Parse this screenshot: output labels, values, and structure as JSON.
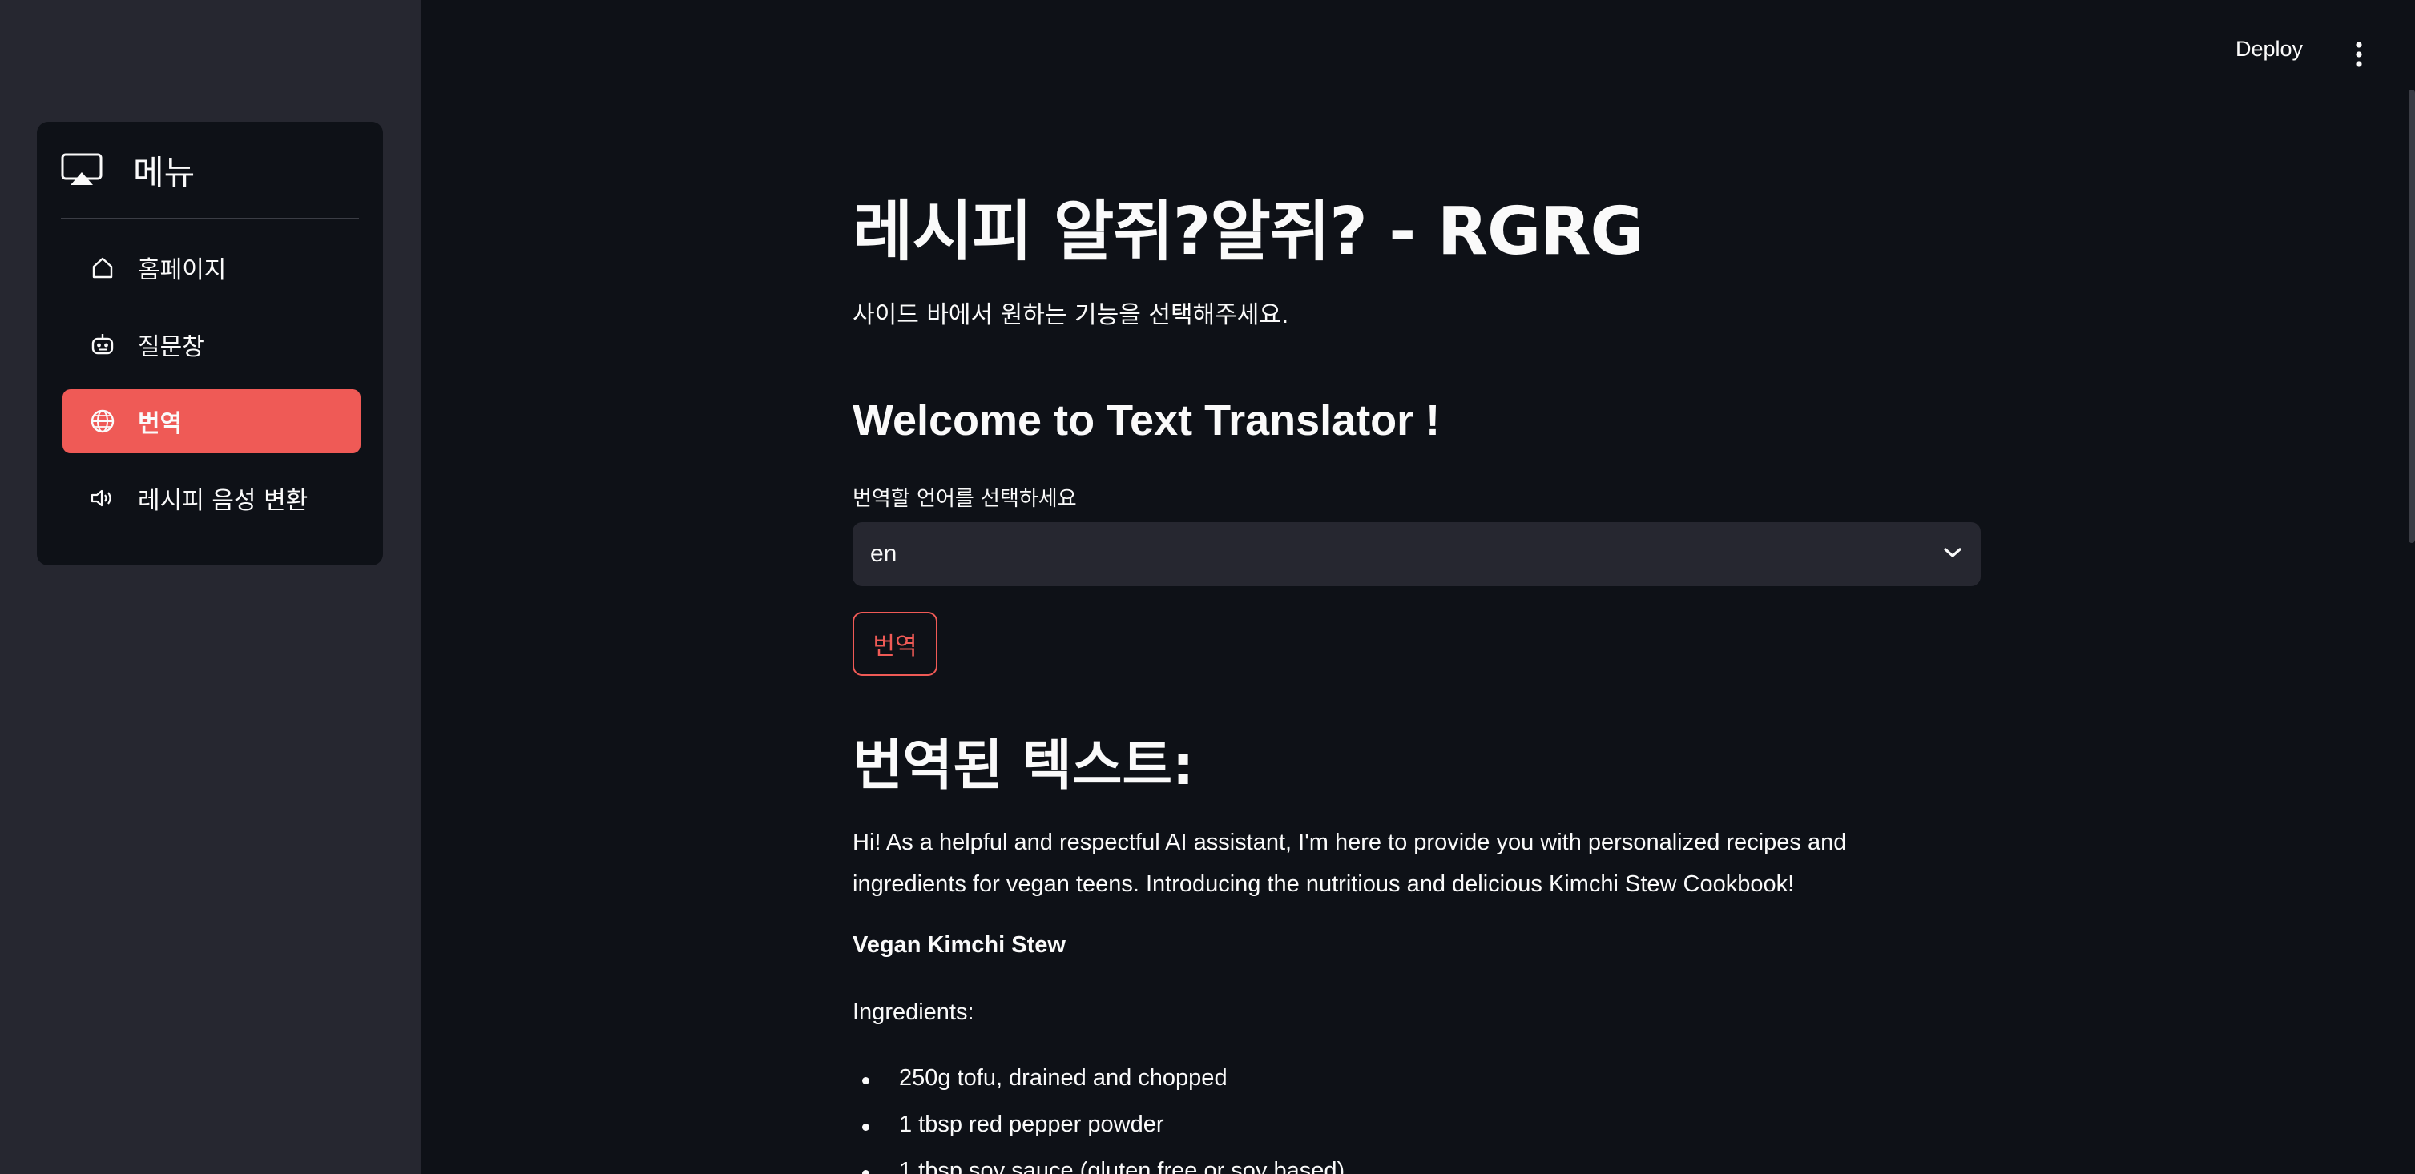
{
  "sidebar": {
    "menu_title": "메뉴",
    "menu_icon": "airplay-icon",
    "items": [
      {
        "label": "홈페이지",
        "icon": "house-icon",
        "active": false
      },
      {
        "label": "질문창",
        "icon": "robot-icon",
        "active": false
      },
      {
        "label": "번역",
        "icon": "globe-icon",
        "active": true
      },
      {
        "label": "레시피 음성 변환",
        "icon": "speaker-icon",
        "active": false
      }
    ]
  },
  "header": {
    "deploy_label": "Deploy",
    "menu_icon": "kebab-menu-icon"
  },
  "main": {
    "title": "레시피 알쥐?알쥐? - RGRG",
    "subtitle": "사이드 바에서 원하는 기능을 선택해주세요.",
    "section_heading": "Welcome to Text Translator !",
    "select_label": "번역할 언어를 선택하세요",
    "select_value": "en",
    "translate_button": "번역",
    "result_heading": "번역된 텍스트:",
    "result_paragraph": "Hi! As a helpful and respectful AI assistant, I'm here to provide you with personalized recipes and ingredients for vegan teens. Introducing the nutritious and delicious Kimchi Stew Cookbook!",
    "recipe_title": "Vegan Kimchi Stew",
    "ingredients_label": "Ingredients:",
    "ingredients": [
      "250g tofu, drained and chopped",
      "1 tbsp red pepper powder",
      "1 tbsp soy sauce (gluten free or soy based)"
    ]
  },
  "colors": {
    "accent": "#ef5a56",
    "background": "#0e1117",
    "sidebar": "#262730"
  }
}
